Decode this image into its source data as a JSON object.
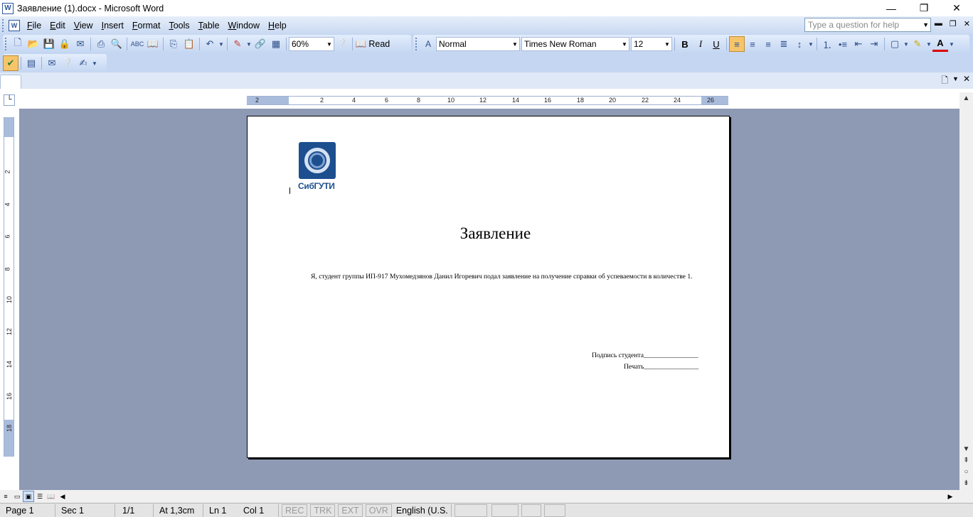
{
  "window": {
    "title": "Заявление (1).docx - Microsoft Word",
    "app_icon": "word-icon",
    "buttons": {
      "minimize": "—",
      "restore": "❐",
      "close": "✕"
    }
  },
  "menu": {
    "items": [
      "File",
      "Edit",
      "View",
      "Insert",
      "Format",
      "Tools",
      "Table",
      "Window",
      "Help"
    ],
    "help_placeholder": "Type a question for help"
  },
  "standard_toolbar": {
    "zoom": "60%",
    "read_label": "Read",
    "icons": [
      "new-icon",
      "open-icon",
      "save-icon",
      "permission-icon",
      "print-icon",
      "print-preview-icon",
      "spelling-icon",
      "research-icon",
      "copy-icon",
      "paste-icon",
      "undo-icon",
      "drawing-icon",
      "hyperlink-icon",
      "table-icon",
      "help-icon"
    ]
  },
  "formatting_toolbar": {
    "style": "Normal",
    "font": "Times New Roman",
    "size": "12",
    "bold": "B",
    "italic": "I",
    "underline": "U",
    "alignment": "left"
  },
  "ruler": {
    "h_numbers": [
      "2",
      "2",
      "4",
      "6",
      "8",
      "10",
      "12",
      "14",
      "16",
      "18",
      "20",
      "22",
      "24",
      "26"
    ],
    "v_numbers": [
      "2",
      "4",
      "6",
      "8",
      "10",
      "12",
      "14",
      "16",
      "18"
    ]
  },
  "document": {
    "logo_text": "СибГУТИ",
    "title": "Заявление",
    "body": "Я, студент группы ИП-917 Мухомедзянов Данил Игоревич подал заявление на получение справки об успеваемости в количестве 1.",
    "signature": "Подпись студента________________",
    "stamp": "Печать________________"
  },
  "status": {
    "page": "Page 1",
    "sec": "Sec 1",
    "pages": "1/1",
    "at": "At 1,3cm",
    "ln": "Ln 1",
    "col": "Col 1",
    "rec": "REC",
    "trk": "TRK",
    "ext": "EXT",
    "ovr": "OVR",
    "language": "English (U.S."
  }
}
